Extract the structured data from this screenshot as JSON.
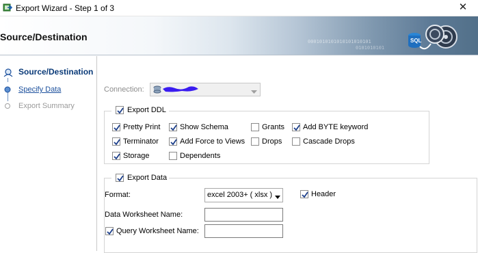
{
  "window": {
    "title": "Export Wizard - Step 1 of 3",
    "close_glyph": "✕"
  },
  "banner": {
    "title": "Source/Destination",
    "binary_line_1": "0001010101010101010101",
    "binary_line_2": "0101010101",
    "graphic_label": "SQL"
  },
  "steps": [
    {
      "label": "Source/Destination",
      "state": "active"
    },
    {
      "label": "Specify Data",
      "state": "link"
    },
    {
      "label": "Export Summary",
      "state": "disabled"
    }
  ],
  "connection": {
    "label": "Connection:",
    "value": "",
    "icon": "database-icon",
    "enabled": false
  },
  "export_ddl": {
    "label": "Export DDL",
    "checked": true,
    "options": [
      {
        "label": "Pretty Print",
        "checked": true
      },
      {
        "label": "Show Schema",
        "checked": true
      },
      {
        "label": "Grants",
        "checked": false
      },
      {
        "label": "Add BYTE keyword",
        "checked": true
      },
      {
        "label": "Terminator",
        "checked": true
      },
      {
        "label": "Add Force to Views",
        "checked": true
      },
      {
        "label": "Drops",
        "checked": false
      },
      {
        "label": "Cascade Drops",
        "checked": false
      },
      {
        "label": "Storage",
        "checked": true
      },
      {
        "label": "Dependents",
        "checked": false
      }
    ]
  },
  "export_data": {
    "label": "Export Data",
    "checked": true,
    "format_label": "Format:",
    "format_value": "excel 2003+ ( xlsx )",
    "header_label": "Header",
    "header_checked": true,
    "data_worksheet_label": "Data Worksheet Name:",
    "data_worksheet_value": "",
    "query_worksheet_label": "Query Worksheet Name:",
    "query_worksheet_checked": true,
    "query_worksheet_value": ""
  },
  "colors": {
    "active_step": "#0a3a78",
    "link_step": "#1b4f9c",
    "disabled_text": "#8c8c8c",
    "redaction": "#3a1cf0"
  }
}
